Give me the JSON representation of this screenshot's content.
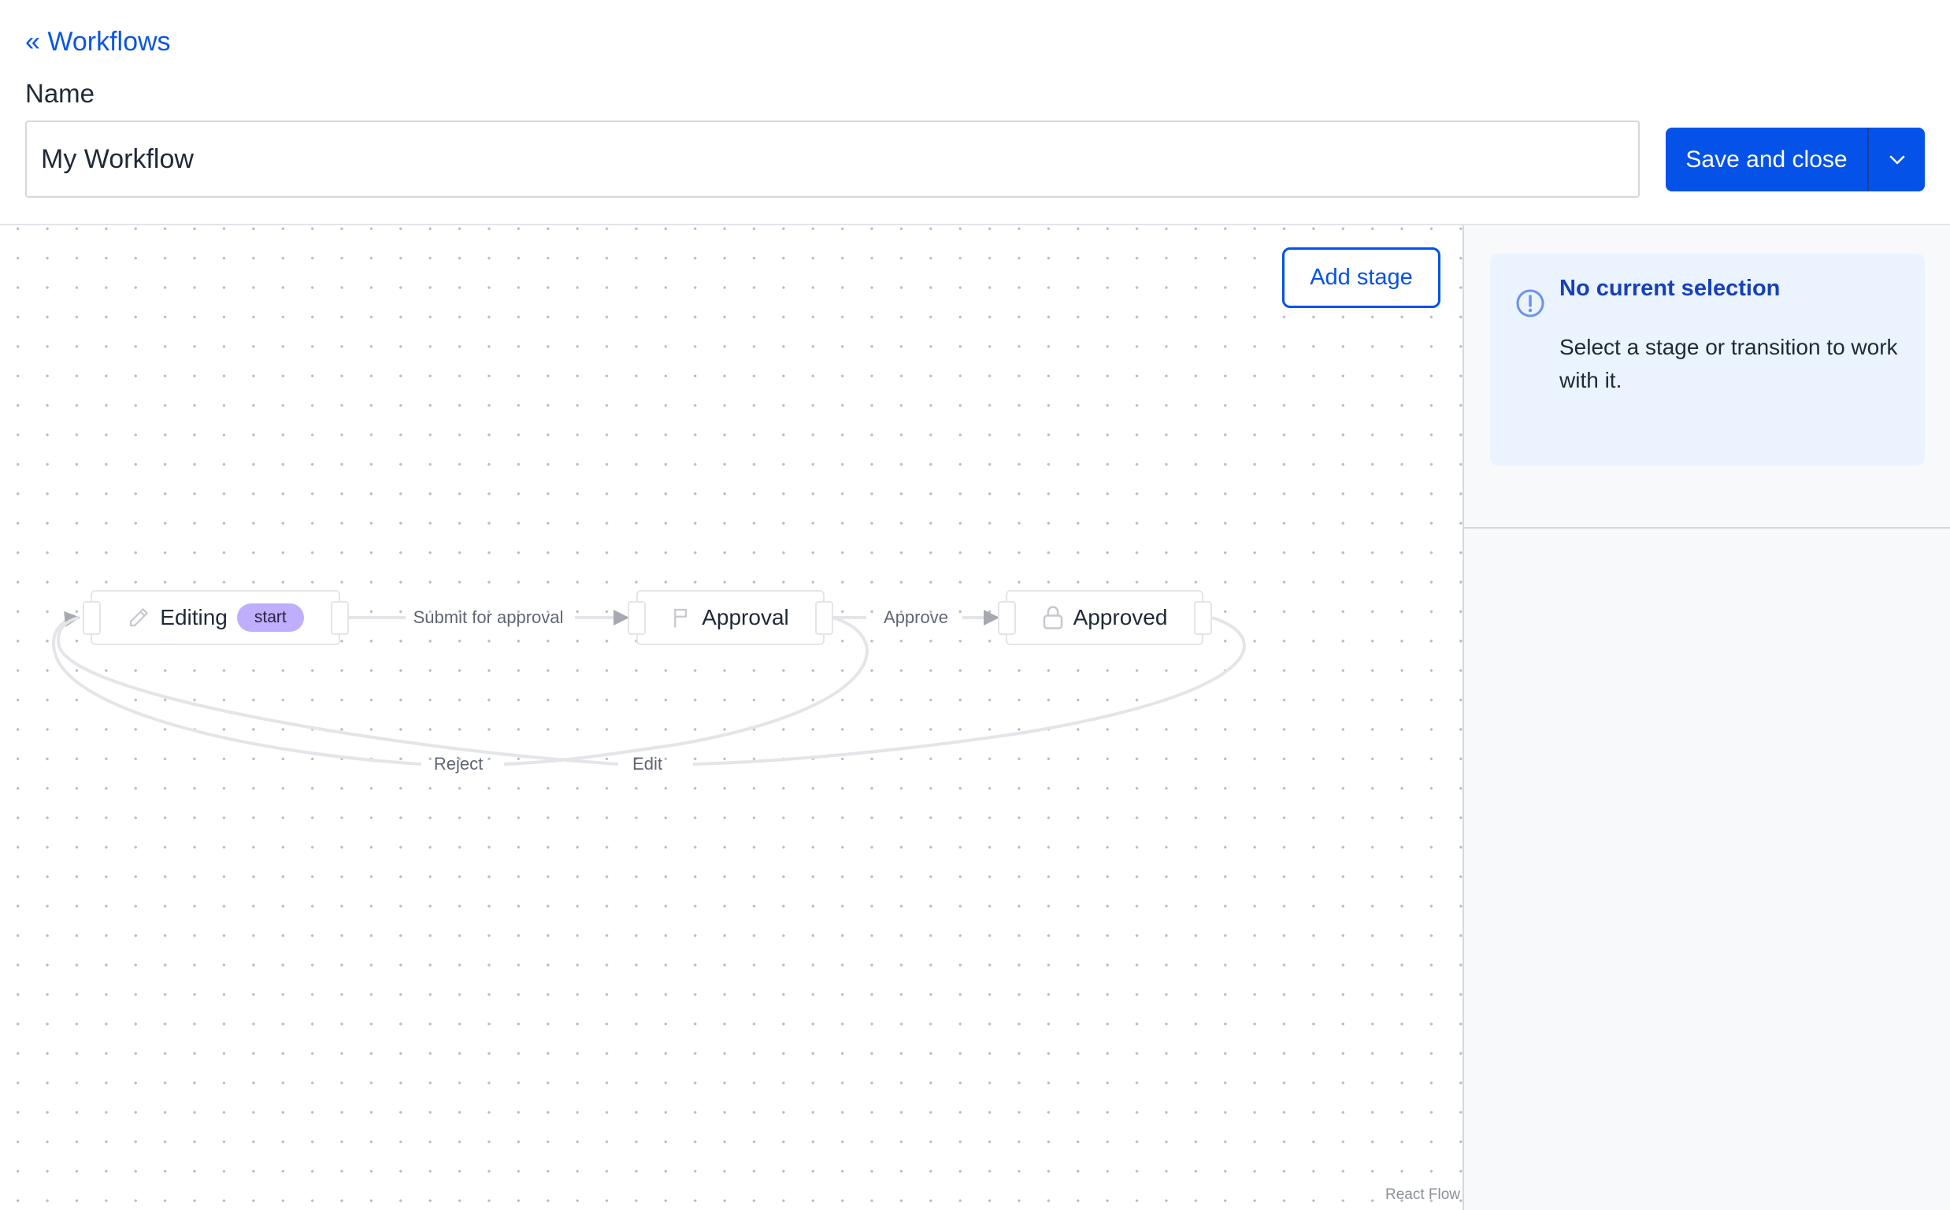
{
  "header": {
    "back_link": "« Workflows",
    "name_label": "Name",
    "name_value": "My Workflow",
    "save_label": "Save and close",
    "save_dropdown_icon": "chevron-down-icon"
  },
  "canvas": {
    "add_stage_label": "Add stage",
    "attribution": "React Flow",
    "nodes": [
      {
        "id": "editing",
        "label": "Editing",
        "icon": "pencil-icon",
        "badge": "start"
      },
      {
        "id": "approval",
        "label": "Approval",
        "icon": "flag-icon",
        "badge": null
      },
      {
        "id": "approved",
        "label": "Approved",
        "icon": "lock-icon",
        "badge": null
      }
    ],
    "edges": [
      {
        "label": "Submit for approval",
        "from": "editing",
        "to": "approval"
      },
      {
        "label": "Approve",
        "from": "approval",
        "to": "approved"
      },
      {
        "label": "Reject",
        "from": "approval",
        "to": "editing"
      },
      {
        "label": "Edit",
        "from": "approved",
        "to": "editing"
      }
    ]
  },
  "panel": {
    "info_icon": "exclamation-circle-icon",
    "title": "No current selection",
    "body": "Select a stage or transition to work with it."
  },
  "colors": {
    "primary": "#0452e8",
    "badge": "#bfaefc",
    "info_bg": "#eaf3fe",
    "info_title": "#1740b8"
  }
}
